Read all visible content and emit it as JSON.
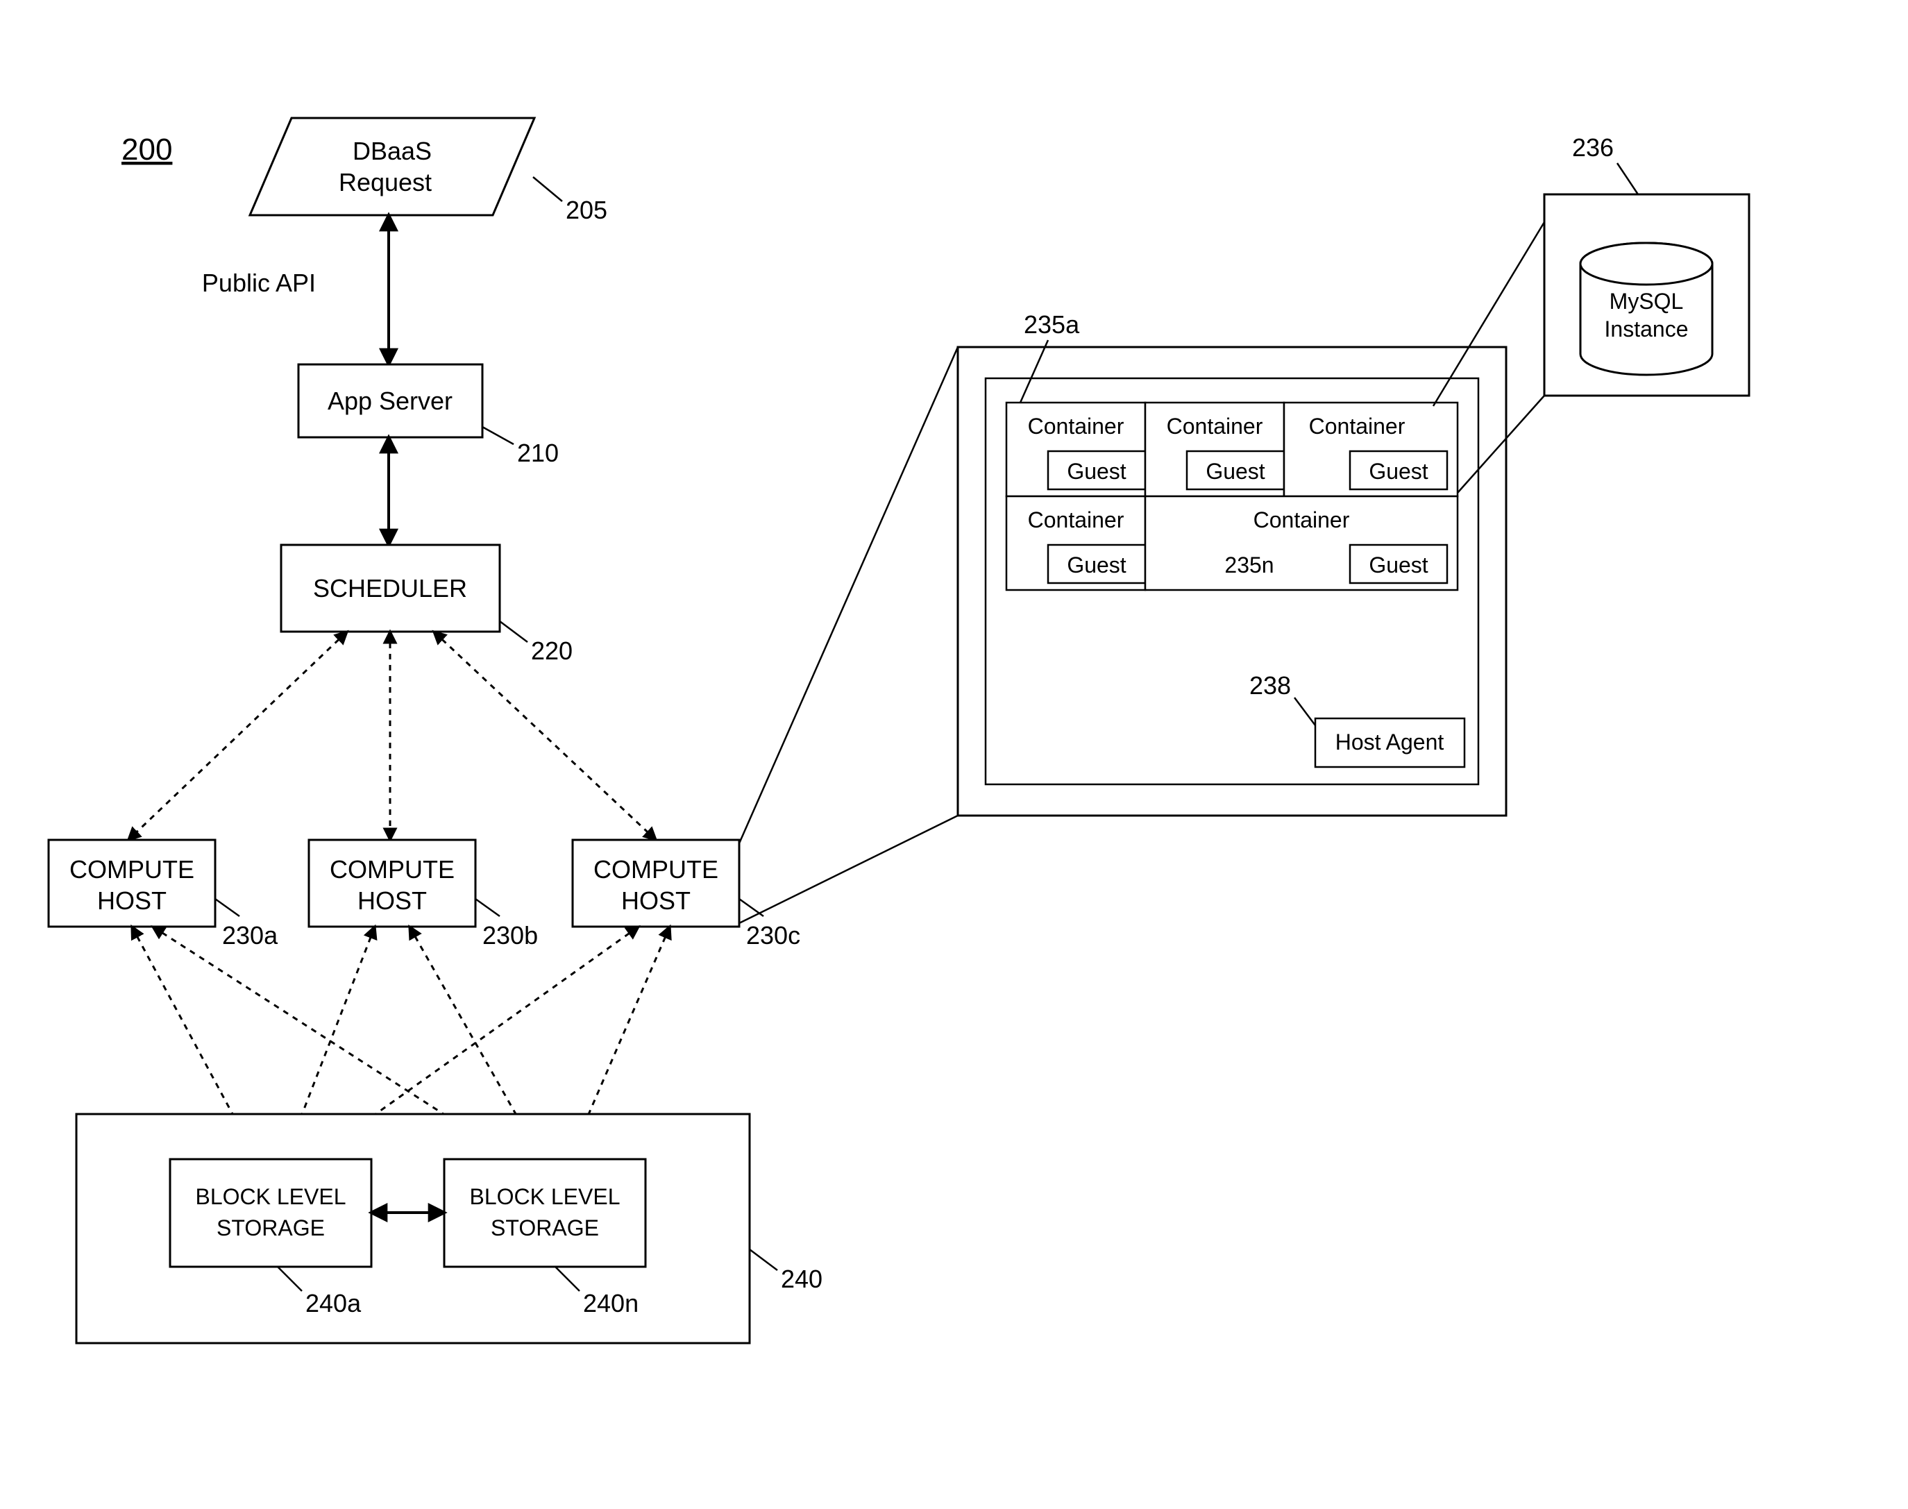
{
  "figure_ref": "200",
  "nodes": {
    "request": {
      "line1": "DBaaS",
      "line2": "Request",
      "ref": "205"
    },
    "api_label": "Public API",
    "app_server": {
      "label": "App Server",
      "ref": "210"
    },
    "scheduler": {
      "label": "SCHEDULER",
      "ref": "220"
    },
    "host_a": {
      "line1": "COMPUTE",
      "line2": "HOST",
      "ref": "230a"
    },
    "host_b": {
      "line1": "COMPUTE",
      "line2": "HOST",
      "ref": "230b"
    },
    "host_c": {
      "line1": "COMPUTE",
      "line2": "HOST",
      "ref": "230c"
    },
    "storage_group": {
      "ref": "240"
    },
    "storage_a": {
      "line1": "BLOCK LEVEL",
      "line2": "STORAGE",
      "ref": "240a"
    },
    "storage_n": {
      "line1": "BLOCK LEVEL",
      "line2": "STORAGE",
      "ref": "240n"
    }
  },
  "detail": {
    "container_ref_first": "235a",
    "container_ref_last": "235n",
    "container_label": "Container",
    "guest_label": "Guest",
    "host_agent": {
      "label": "Host Agent",
      "ref": "238"
    },
    "mysql": {
      "line1": "MySQL",
      "line2": "Instance",
      "ref": "236"
    }
  }
}
